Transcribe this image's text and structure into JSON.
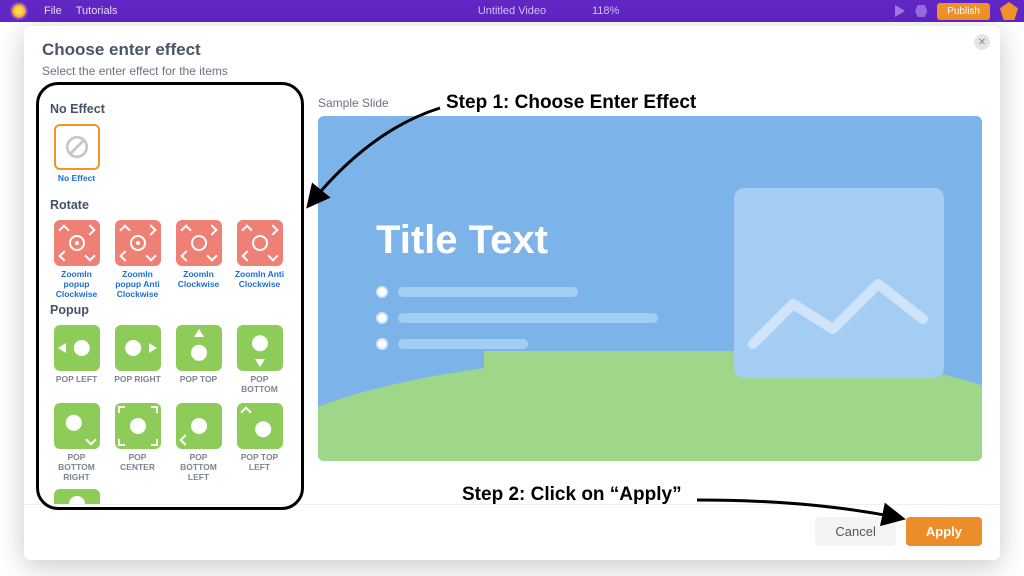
{
  "topbar": {
    "menu_file": "File",
    "menu_tutorials": "Tutorials",
    "title": "Untitled Video",
    "zoom": "118%",
    "publish": "Publish"
  },
  "modal": {
    "title": "Choose enter effect",
    "subtitle": "Select the enter effect for the items",
    "preview_label": "Sample Slide",
    "sample_title": "Title Text",
    "cancel": "Cancel",
    "apply": "Apply"
  },
  "sections": {
    "none": "No Effect",
    "rotate": "Rotate",
    "popup": "Popup"
  },
  "effects": {
    "none": {
      "label": "No Effect"
    },
    "rotate": [
      {
        "label": "ZoomIn popup Clockwise"
      },
      {
        "label": "ZoomIn popup Anti Clockwise"
      },
      {
        "label": "ZoomIn Clockwise"
      },
      {
        "label": "ZoomIn Anti Clockwise"
      }
    ],
    "popup": [
      {
        "label": "POP LEFT"
      },
      {
        "label": "POP RIGHT"
      },
      {
        "label": "POP TOP"
      },
      {
        "label": "POP BOTTOM"
      },
      {
        "label": "POP BOTTOM RIGHT"
      },
      {
        "label": "POP CENTER"
      },
      {
        "label": "POP BOTTOM LEFT"
      },
      {
        "label": "POP TOP LEFT"
      }
    ]
  },
  "annotations": {
    "step1": "Step 1: Choose Enter Effect",
    "step2": "Step 2: Click on “Apply”"
  }
}
